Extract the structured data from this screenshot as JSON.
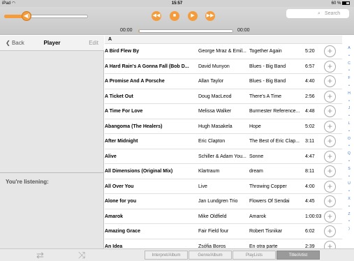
{
  "status": {
    "device": "iPad",
    "wifi": "wifi-icon",
    "time": "15:57",
    "battery": "60 %"
  },
  "player": {
    "volume_level": 0.27,
    "elapsed": "00:00",
    "remaining": "00:00",
    "progress": 0.01,
    "controls": [
      "rewind-icon",
      "stop-icon",
      "play-icon",
      "fast-forward-icon"
    ],
    "search_placeholder": "Search",
    "accent": "#f49c3c"
  },
  "nav": {
    "back": "Back",
    "title": "Player",
    "edit": "Edit"
  },
  "now_playing": {
    "label": "You're listening:"
  },
  "list": {
    "section": "A",
    "rows": [
      {
        "title": "A Bird Flew By",
        "artist": "George Mraz & Emil...",
        "album": "Together Again",
        "duration": "5:20"
      },
      {
        "title": "A Hard Rain's A Gonna Fall (Bob D...",
        "artist": "David Munyon",
        "album": "Blues - Big Band",
        "duration": "6:57"
      },
      {
        "title": "A Promise And A Porsche",
        "artist": "Allan Taylor",
        "album": "Blues - Big Band",
        "duration": "4:40"
      },
      {
        "title": "A Ticket Out",
        "artist": "Doug MacLeod",
        "album": "There's A Time",
        "duration": "2:56"
      },
      {
        "title": "A Time For Love",
        "artist": "Melissa Walker",
        "album": "Burmester Reference...",
        "duration": "4:48"
      },
      {
        "title": "Abangoma (The Healers)",
        "artist": "Hugh Masakela",
        "album": "Hope",
        "duration": "5:02"
      },
      {
        "title": "After Midnight",
        "artist": "Eric Clapton",
        "album": "The Best of Eric Clap...",
        "duration": "3:11"
      },
      {
        "title": "Alive",
        "artist": "Schiller & Adam You...",
        "album": "Sonne",
        "duration": "4:47"
      },
      {
        "title": "All Dimensions (Original Mix)",
        "artist": "Klartraum",
        "album": "dream",
        "duration": "8:11"
      },
      {
        "title": "All Over You",
        "artist": "Live",
        "album": "Throwing Copper",
        "duration": "4:00"
      },
      {
        "title": "Alone for you",
        "artist": "Jan Lundgren Trio",
        "album": "Flowers Of Sendai",
        "duration": "4:45"
      },
      {
        "title": "Amarok",
        "artist": "Mike Oldfield",
        "album": "Amarok",
        "duration": "1:00:03"
      },
      {
        "title": "Amazing Grace",
        "artist": "Fair Field four",
        "album": "Robert Tisnikar",
        "duration": "6:02"
      },
      {
        "title": "An Idea",
        "artist": "Zsófia Boros",
        "album": "En otra parte",
        "duration": "2:39"
      }
    ]
  },
  "index": [
    "A",
    "•",
    "C",
    "•",
    "F",
    "•",
    "H",
    "•",
    "J",
    "•",
    "L",
    "•",
    "O",
    "•",
    "Q",
    "•",
    "S",
    "•",
    "U",
    "•",
    "X",
    "•",
    "Z",
    "•",
    ")"
  ],
  "bottom": {
    "repeat_icon": "repeat-icon",
    "shuffle_icon": "shuffle-icon",
    "tabs": [
      "Interpret/Album",
      "Genre/Album",
      "PlayLists",
      "Title/Artist"
    ],
    "active_tab": 3
  }
}
